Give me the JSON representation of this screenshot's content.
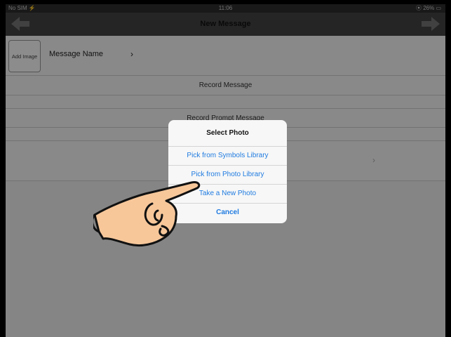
{
  "statusbar": {
    "carrier": "No SIM ⚡",
    "time": "11:06",
    "battery": "⦿ 26% ▭"
  },
  "navbar": {
    "title": "New Message",
    "back_icon": "arrow-left-icon",
    "forward_icon": "arrow-right-icon"
  },
  "form": {
    "add_image_label": "Add Image",
    "message_name_label": "Message Name",
    "message_name_chevron": "›",
    "record_message_label": "Record Message",
    "record_prompt_label": "Record Prompt Message",
    "row_chevron": "›"
  },
  "action_sheet": {
    "title": "Select Photo",
    "options": [
      {
        "label": "Pick from Symbols Library"
      },
      {
        "label": "Pick from Photo Library"
      },
      {
        "label": "Take a New Photo"
      },
      {
        "label": "Cancel"
      }
    ]
  },
  "colors": {
    "accent": "#1f7be0",
    "navbar": "#444444",
    "hand_fill": "#f7c79a"
  }
}
